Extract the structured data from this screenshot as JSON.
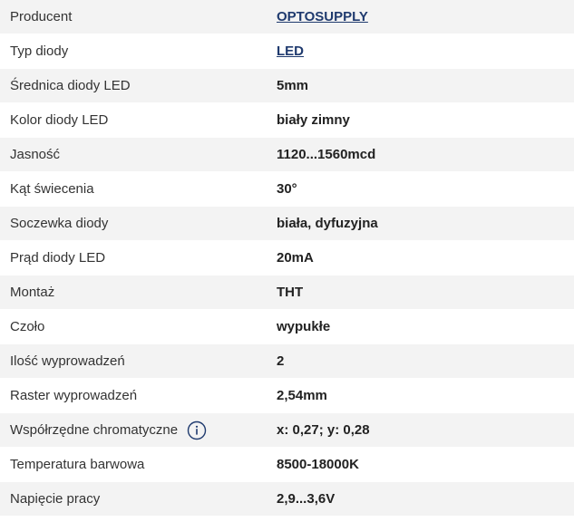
{
  "colors": {
    "link": "#1f3a6e",
    "row_alt": "#f3f3f3",
    "icon": "#1f3a6e"
  },
  "specs": [
    {
      "label": "Producent",
      "value": "OPTOSUPPLY",
      "link": true
    },
    {
      "label": "Typ diody",
      "value": "LED",
      "link": true
    },
    {
      "label": "Średnica diody LED",
      "value": "5mm"
    },
    {
      "label": "Kolor diody LED",
      "value": "biały zimny"
    },
    {
      "label": "Jasność",
      "value": "1120...1560mcd"
    },
    {
      "label": "Kąt świecenia",
      "value": "30°"
    },
    {
      "label": "Soczewka diody",
      "value": "biała, dyfuzyjna"
    },
    {
      "label": "Prąd diody LED",
      "value": "20mA"
    },
    {
      "label": "Montaż",
      "value": "THT"
    },
    {
      "label": "Czoło",
      "value": "wypukłe"
    },
    {
      "label": "Ilość wyprowadzeń",
      "value": "2"
    },
    {
      "label": "Raster wyprowadzeń",
      "value": "2,54mm"
    },
    {
      "label": "Współrzędne chromatyczne",
      "value": "x: 0,27; y: 0,28",
      "icon": "info-icon"
    },
    {
      "label": "Temperatura barwowa",
      "value": "8500-18000K"
    },
    {
      "label": "Napięcie pracy",
      "value": "2,9...3,6V"
    }
  ]
}
